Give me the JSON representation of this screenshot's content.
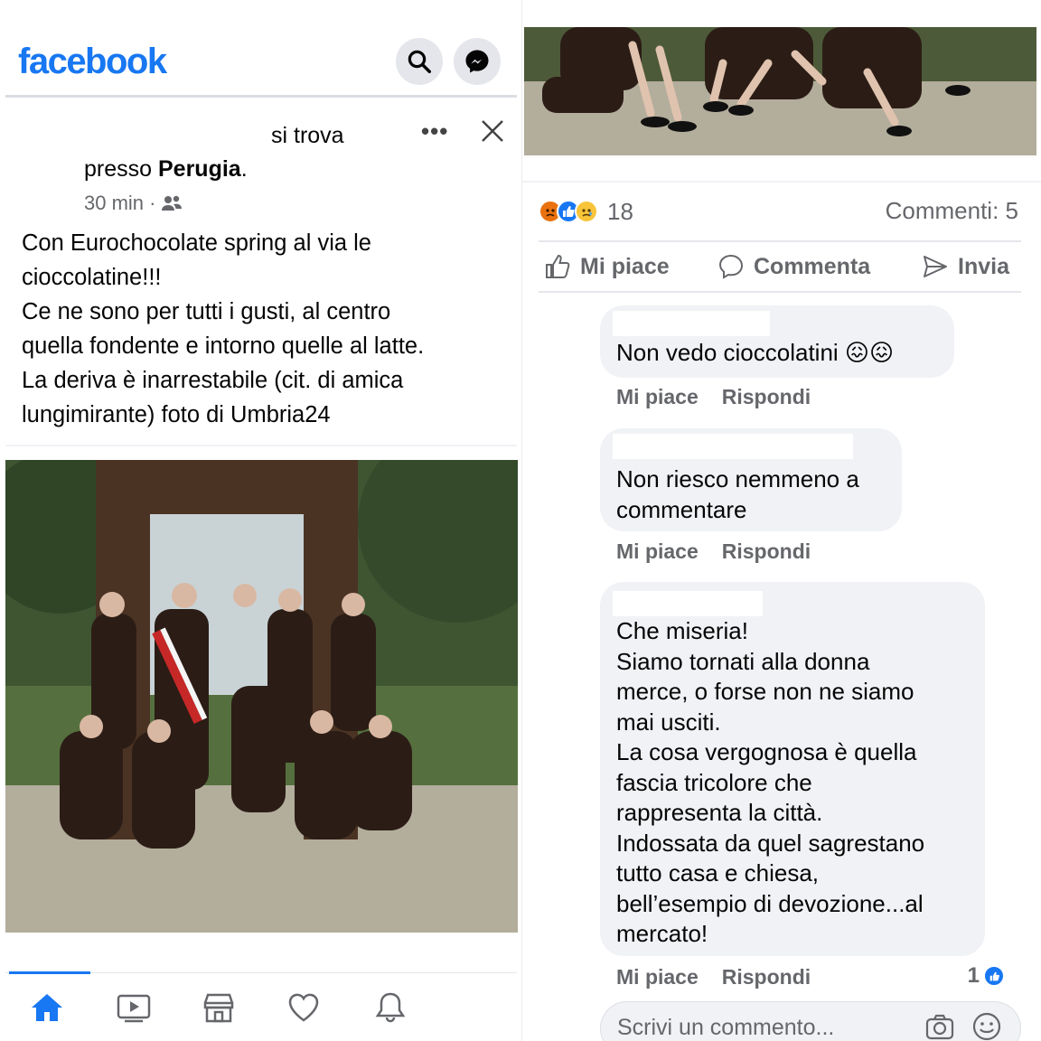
{
  "left": {
    "header": {
      "logo": "facebook"
    },
    "post": {
      "location_line1": "si trova",
      "location_prefix": "presso ",
      "location_place": "Perugia",
      "location_suffix": ".",
      "time": "30 min ·",
      "more": "•••",
      "text_lines": [
        "Con Eurochocolate spring al via le",
        "cioccolatine!!!",
        "Ce ne sono per tutti i gusti, al centro",
        "quella fondente e intorno quelle al latte.",
        "La deriva è inarrestabile (cit. di amica",
        "lungimirante) foto di Umbria24"
      ]
    },
    "nav": [
      "home-icon",
      "video-icon",
      "marketplace-icon",
      "dating-icon",
      "notifications-icon"
    ]
  },
  "right": {
    "reactions_count": "18",
    "comments_count": "Commenti: 5",
    "actions": {
      "like": "Mi piace",
      "comment": "Commenta",
      "send": "Invia"
    },
    "comments": [
      {
        "text": "Non vedo cioccolatini 😖😖",
        "like": "Mi piace",
        "reply": "Rispondi"
      },
      {
        "text_lines": [
          "Non riesco nemmeno a",
          "commentare"
        ],
        "like": "Mi piace",
        "reply": "Rispondi"
      },
      {
        "text_lines": [
          "Che miseria!",
          "Siamo tornati alla donna",
          "merce, o forse non ne siamo",
          "mai usciti.",
          "La cosa vergognosa è quella",
          "fascia tricolore che",
          "rappresenta la città.",
          "Indossata da quel  sagrestano",
          "tutto casa e chiesa,",
          "bell’esempio di devozione...al",
          "mercato!"
        ],
        "like": "Mi piace",
        "reply": "Rispondi",
        "likes": "1"
      }
    ],
    "write_placeholder": "Scrivi un commento..."
  },
  "colors": {
    "brand": "#1877f2",
    "muted": "#65676b",
    "bubble": "#f0f2f5"
  }
}
